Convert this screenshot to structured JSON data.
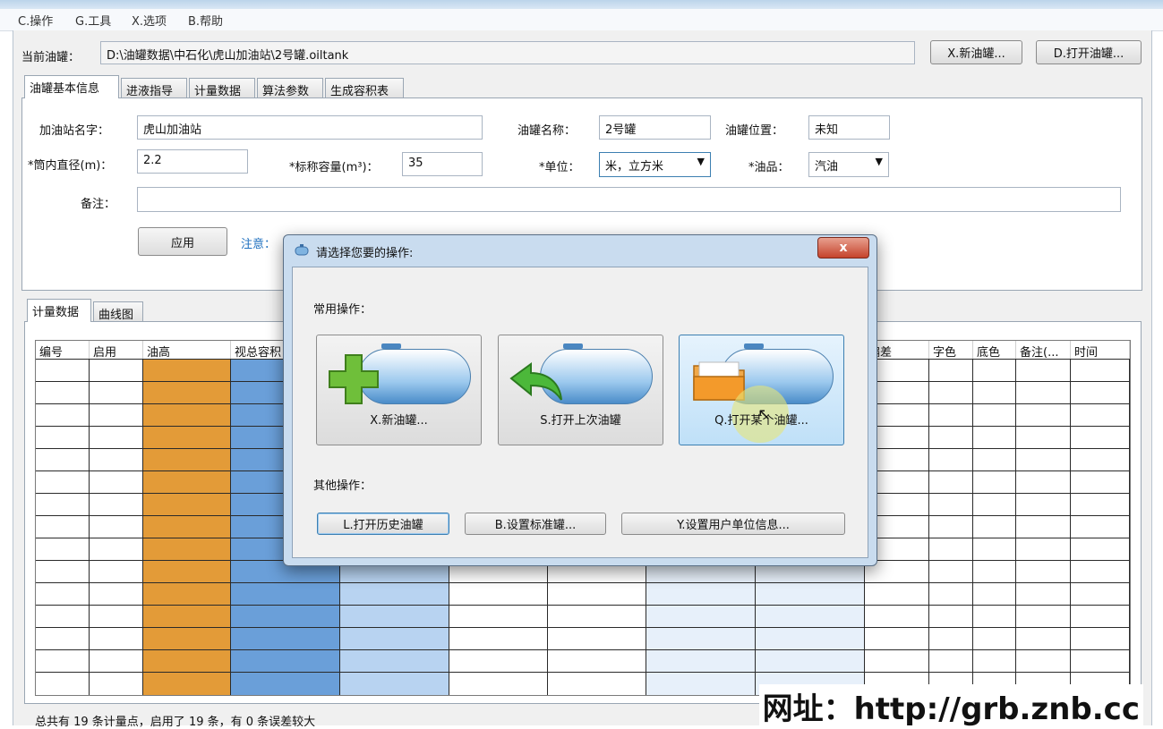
{
  "menu": [
    "C.操作",
    "G.工具",
    "X.选项",
    "B.帮助"
  ],
  "current_tank": {
    "label": "当前油罐：",
    "path": "D:\\油罐数据\\中石化\\虎山加油站\\2号罐.oiltank"
  },
  "top_buttons": {
    "new": "X.新油罐...",
    "open": "D.打开油罐..."
  },
  "tabs": [
    "油罐基本信息",
    "进液指导",
    "计量数据",
    "算法参数",
    "生成容积表"
  ],
  "form": {
    "station_label": "加油站名字：",
    "station_value": "虎山加油站",
    "tank_name_label": "油罐名称：",
    "tank_name_value": "2号罐",
    "tank_pos_label": "油罐位置：",
    "tank_pos_value": "未知",
    "diameter_label": "*筒内直径(m)：",
    "diameter_value": "2.2",
    "capacity_label": "*标称容量(m³)：",
    "capacity_value": "35",
    "unit_label": "*单位：",
    "unit_value": "米，立方米",
    "oil_label": "*油品：",
    "oil_value": "汽油",
    "note_label": "备注：",
    "note_value": "",
    "apply": "应用",
    "hint": "注意："
  },
  "sub_tabs": [
    "计量数据",
    "曲线图"
  ],
  "grid": {
    "headers_left": [
      "编号",
      "启用",
      "油高",
      "视总容积"
    ],
    "headers_right": [
      "偏差",
      "字色",
      "底色",
      "备注(...",
      "时间"
    ],
    "rows": 15
  },
  "dialog": {
    "title": "请选择您要的操作:",
    "close": "x",
    "common_label": "常用操作：",
    "big_buttons": [
      "X.新油罐...",
      "S.打开上次油罐",
      "Q.打开某个油罐..."
    ],
    "other_label": "其他操作：",
    "small_buttons": [
      "L.打开历史油罐",
      "B.设置标准罐...",
      "Y.设置用户单位信息..."
    ]
  },
  "footer": "总共有 19 条计量点，启用了 19 条，有 0 条误差较大",
  "watermark": "网址：http://grb.znb.cc",
  "colors": {
    "orange": "#e39b38",
    "blue": "#6a9fd9",
    "light_blue": "#b8d3f1",
    "pale_blue": "#e7f0fa"
  }
}
